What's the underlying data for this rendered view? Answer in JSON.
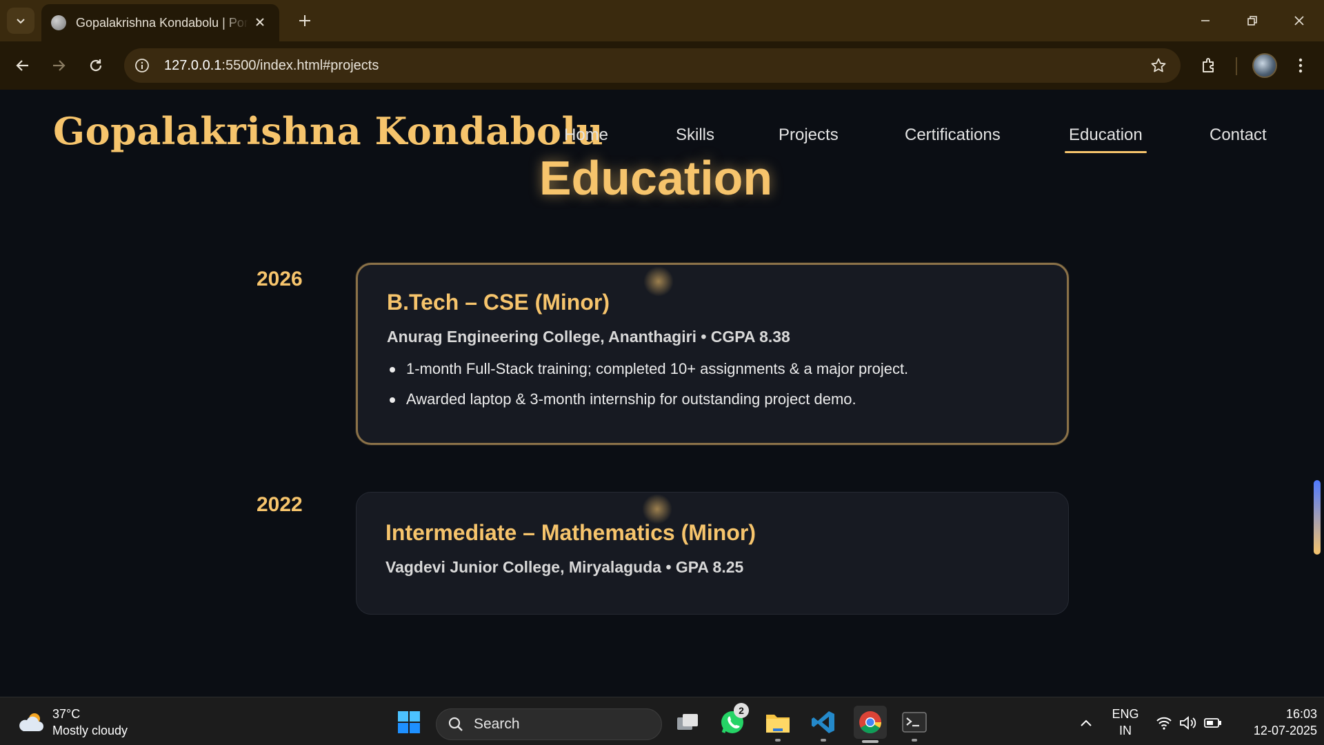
{
  "browser": {
    "tab_title": "Gopalakrishna Kondabolu | Portfolio",
    "url_host": "127.0.0.1",
    "url_rest": ":5500/index.html#projects"
  },
  "site": {
    "brand": "Gopalakrishna Kondabolu",
    "nav": [
      "Home",
      "Skills",
      "Projects",
      "Certifications",
      "Education",
      "Contact"
    ],
    "active_nav": "Education",
    "section_title": "Education",
    "entries": [
      {
        "year": "2026",
        "title": "B.Tech – CSE (Minor)",
        "subtitle": "Anurag Engineering College, Ananthagiri • CGPA 8.38",
        "bullets": [
          "1-month Full-Stack training; completed 10+ assignments & a major project.",
          "Awarded laptop & 3-month internship for outstanding project demo."
        ]
      },
      {
        "year": "2022",
        "title": "Intermediate – Mathematics (Minor)",
        "subtitle": "Vagdevi Junior College, Miryalaguda • GPA 8.25",
        "bullets": []
      }
    ]
  },
  "taskbar": {
    "weather_temp": "37°C",
    "weather_desc": "Mostly cloudy",
    "search_label": "Search",
    "whatsapp_badge": "2",
    "lang_line1": "ENG",
    "lang_line2": "IN",
    "time": "16:03",
    "date": "12-07-2025"
  },
  "colors": {
    "accent": "#f6c46c",
    "page_bg": "#0b0e14",
    "card_bg": "#171a22",
    "chrome_bg": "#231907"
  },
  "icons": [
    "tab-search-icon",
    "globe-favicon-icon",
    "close-icon",
    "plus-icon",
    "minimize-icon",
    "restore-icon",
    "back-icon",
    "forward-icon",
    "reload-icon",
    "info-icon",
    "star-icon",
    "extensions-icon",
    "kebab-menu-icon",
    "windows-start-icon",
    "search-icon",
    "task-view-icon",
    "whatsapp-icon",
    "file-explorer-icon",
    "vscode-icon",
    "chrome-icon",
    "terminal-icon",
    "chevron-up-icon",
    "wifi-icon",
    "volume-icon",
    "battery-icon",
    "weather-cloud-icon"
  ]
}
